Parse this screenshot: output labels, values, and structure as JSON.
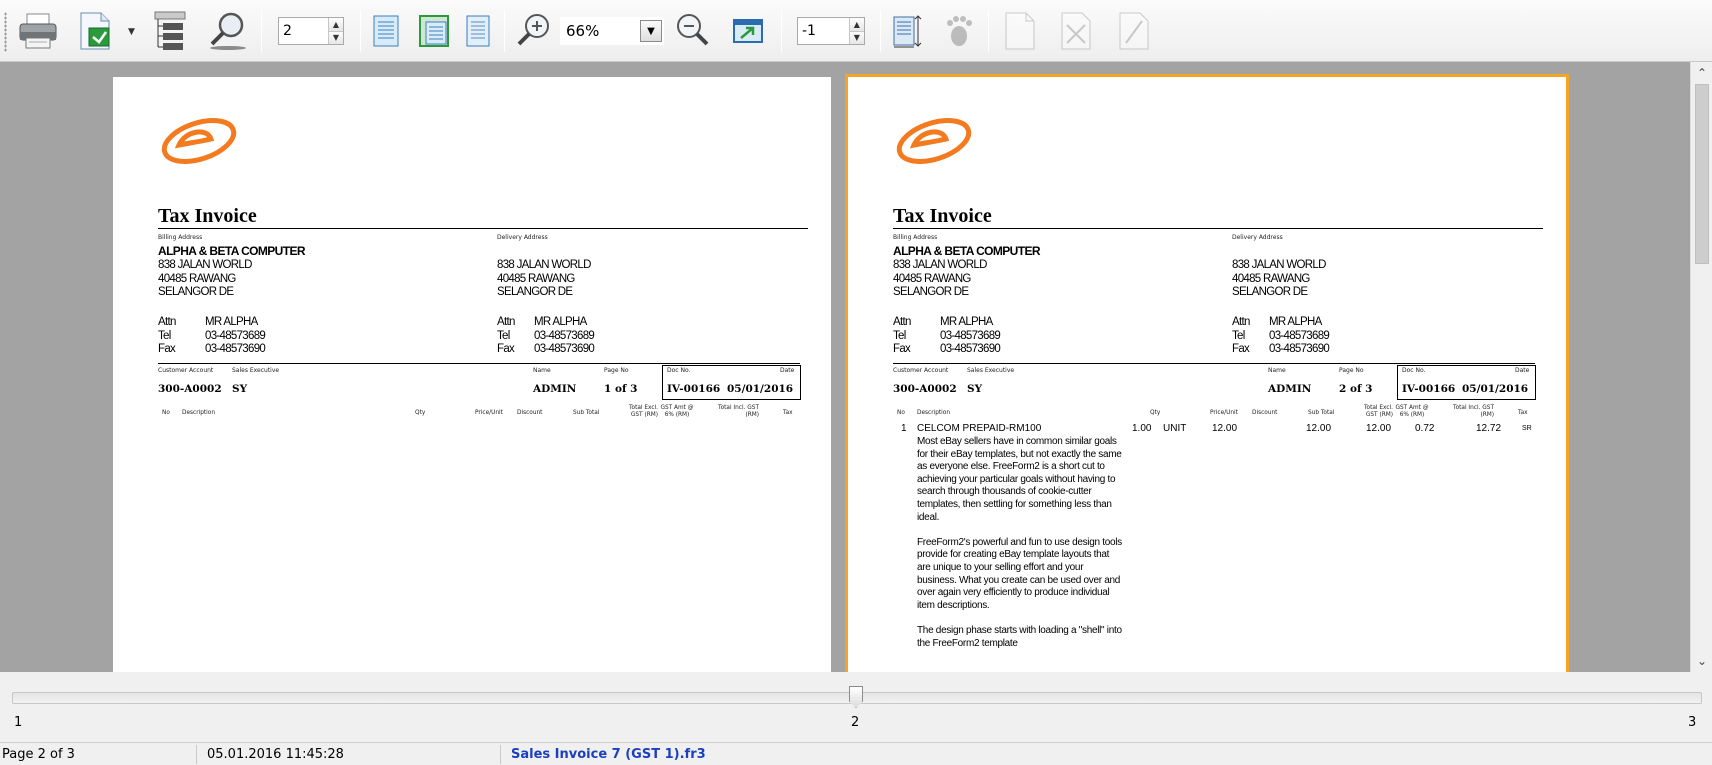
{
  "toolbar": {
    "page_spin_value": "2",
    "zoom_value": "66%",
    "offset_spin_value": "-1",
    "accent_color": "#2a9a3c"
  },
  "pages": [
    {
      "current": false,
      "title": "Tax Invoice",
      "billing_label": "Billing Address",
      "delivery_label": "Delivery Address",
      "billing_company": "ALPHA & BETA COMPUTER",
      "billing_address": [
        "838 JALAN WORLD",
        "40485 RAWANG",
        "SELANGOR DE"
      ],
      "delivery_address": [
        "838 JALAN WORLD",
        "40485 RAWANG",
        "SELANGOR DE"
      ],
      "attn_label": "Attn",
      "tel_label": "Tel",
      "fax_label": "Fax",
      "attn": "MR ALPHA",
      "tel": "03-48573689",
      "fax": "03-48573690",
      "delivery_attn": "MR ALPHA",
      "delivery_tel": "03-48573689",
      "delivery_fax": "03-48573690",
      "customer_account_label": "Customer Account",
      "sales_exec_label": "Sales Executive",
      "name_label": "Name",
      "page_no_label": "Page No",
      "doc_no_label": "Doc No.",
      "date_label": "Date",
      "customer_account": "300-A0002",
      "sales_exec": "SY",
      "name": "ADMIN",
      "page_no": "1 of 3",
      "doc_no": "IV-00166",
      "date": "05/01/2016",
      "columns": {
        "no": "No",
        "description": "Description",
        "qty": "Qty",
        "price": "Price/Unit",
        "discount": "Discount",
        "subtotal": "Sub Total",
        "total_excl": "Total Excl. GST (RM)",
        "gst_amt": "GST Amt @ 6% (RM)",
        "total_incl": "Total Incl. GST (RM)",
        "tax": "Tax"
      },
      "items": []
    },
    {
      "current": true,
      "title": "Tax Invoice",
      "billing_label": "Billing Address",
      "delivery_label": "Delivery Address",
      "billing_company": "ALPHA & BETA COMPUTER",
      "billing_address": [
        "838 JALAN WORLD",
        "40485 RAWANG",
        "SELANGOR DE"
      ],
      "delivery_address": [
        "838 JALAN WORLD",
        "40485 RAWANG",
        "SELANGOR DE"
      ],
      "attn_label": "Attn",
      "tel_label": "Tel",
      "fax_label": "Fax",
      "attn": "MR ALPHA",
      "tel": "03-48573689",
      "fax": "03-48573690",
      "delivery_attn": "MR ALPHA",
      "delivery_tel": "03-48573689",
      "delivery_fax": "03-48573690",
      "customer_account_label": "Customer Account",
      "sales_exec_label": "Sales Executive",
      "name_label": "Name",
      "page_no_label": "Page No",
      "doc_no_label": "Doc No.",
      "date_label": "Date",
      "customer_account": "300-A0002",
      "sales_exec": "SY",
      "name": "ADMIN",
      "page_no": "2 of 3",
      "doc_no": "IV-00166",
      "date": "05/01/2016",
      "columns": {
        "no": "No",
        "description": "Description",
        "qty": "Qty",
        "price": "Price/Unit",
        "discount": "Discount",
        "subtotal": "Sub Total",
        "total_excl": "Total Excl. GST (RM)",
        "gst_amt": "GST Amt @ 6% (RM)",
        "total_incl": "Total Incl. GST (RM)",
        "tax": "Tax"
      },
      "items": [
        {
          "no": "1",
          "description": "CELCOM PREPAID-RM100",
          "qty": "1.00",
          "uom": "UNIT",
          "price": "12.00",
          "subtotal": "12.00",
          "total_excl": "12.00",
          "gst_amt": "0.72",
          "total_incl": "12.72",
          "tax": "SR",
          "details": [
            "Most eBay sellers have in common similar goals for their eBay templates, but not exactly the same as everyone else. FreeForm2 is a short cut to achieving your particular goals without having to search through thousands of cookie-cutter templates, then settling for something less than ideal.",
            "FreeForm2's powerful and fun to use design tools provide for creating eBay template layouts that are unique to your selling effort and your business. What you create can be used over and over again very efficiently to produce individual item descriptions.",
            "The design phase starts with loading a \"shell\" into the FreeForm2 template"
          ]
        }
      ]
    }
  ],
  "slider": {
    "min_label": "1",
    "mid_label": "2",
    "max_label": "3",
    "position": 0.5
  },
  "status": {
    "page": "Page 2 of 3",
    "datetime": "05.01.2016 11:45:28",
    "file": "Sales Invoice 7 (GST 1).fr3",
    "file_color": "#1a3fbf"
  }
}
